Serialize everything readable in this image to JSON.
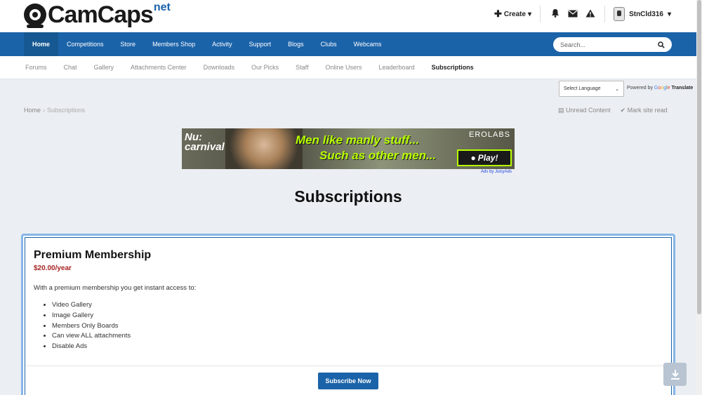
{
  "logo": {
    "name": "CamCaps",
    "suffix": "net"
  },
  "user_bar": {
    "create_label": "Create",
    "username": "StnCld316"
  },
  "nav": {
    "items": [
      "Home",
      "Competitions",
      "Store",
      "Members Shop",
      "Activity",
      "Support",
      "Blogs",
      "Clubs",
      "Webcams"
    ],
    "search_placeholder": "Search..."
  },
  "subnav": {
    "items": [
      "Forums",
      "Chat",
      "Gallery",
      "Attachments Center",
      "Downloads",
      "Our Picks",
      "Staff",
      "Online Users",
      "Leaderboard",
      "Subscriptions"
    ]
  },
  "translate": {
    "select_label": "Select Language",
    "powered_by": "Powered by",
    "google": [
      "G",
      "o",
      "o",
      "g",
      "l",
      "e"
    ],
    "translate_label": "Translate"
  },
  "breadcrumb": {
    "home": "Home",
    "current": "Subscriptions"
  },
  "actions": {
    "unread": "Unread Content",
    "mark_read": "Mark site read"
  },
  "ad": {
    "brand_line1": "Nu:",
    "brand_line2": "carnival",
    "line1": "Men like manly stuff...",
    "line2": "Such as other men...",
    "erolabs": "EROLABS",
    "play": "Play!",
    "by": "Ads by JuicyAds"
  },
  "page_title": "Subscriptions",
  "package": {
    "name": "Premium Membership",
    "price": "$20.00/year",
    "description": "With a premium membership you get instant access to:",
    "features": [
      "Video Gallery",
      "Image Gallery",
      "Members Only Boards",
      "Can view ALL attachments",
      "Disable Ads"
    ],
    "button": "Subscribe Now"
  },
  "colors": {
    "primary": "#1b63a9",
    "price": "#a82424",
    "card_border": "#86b6e6"
  }
}
